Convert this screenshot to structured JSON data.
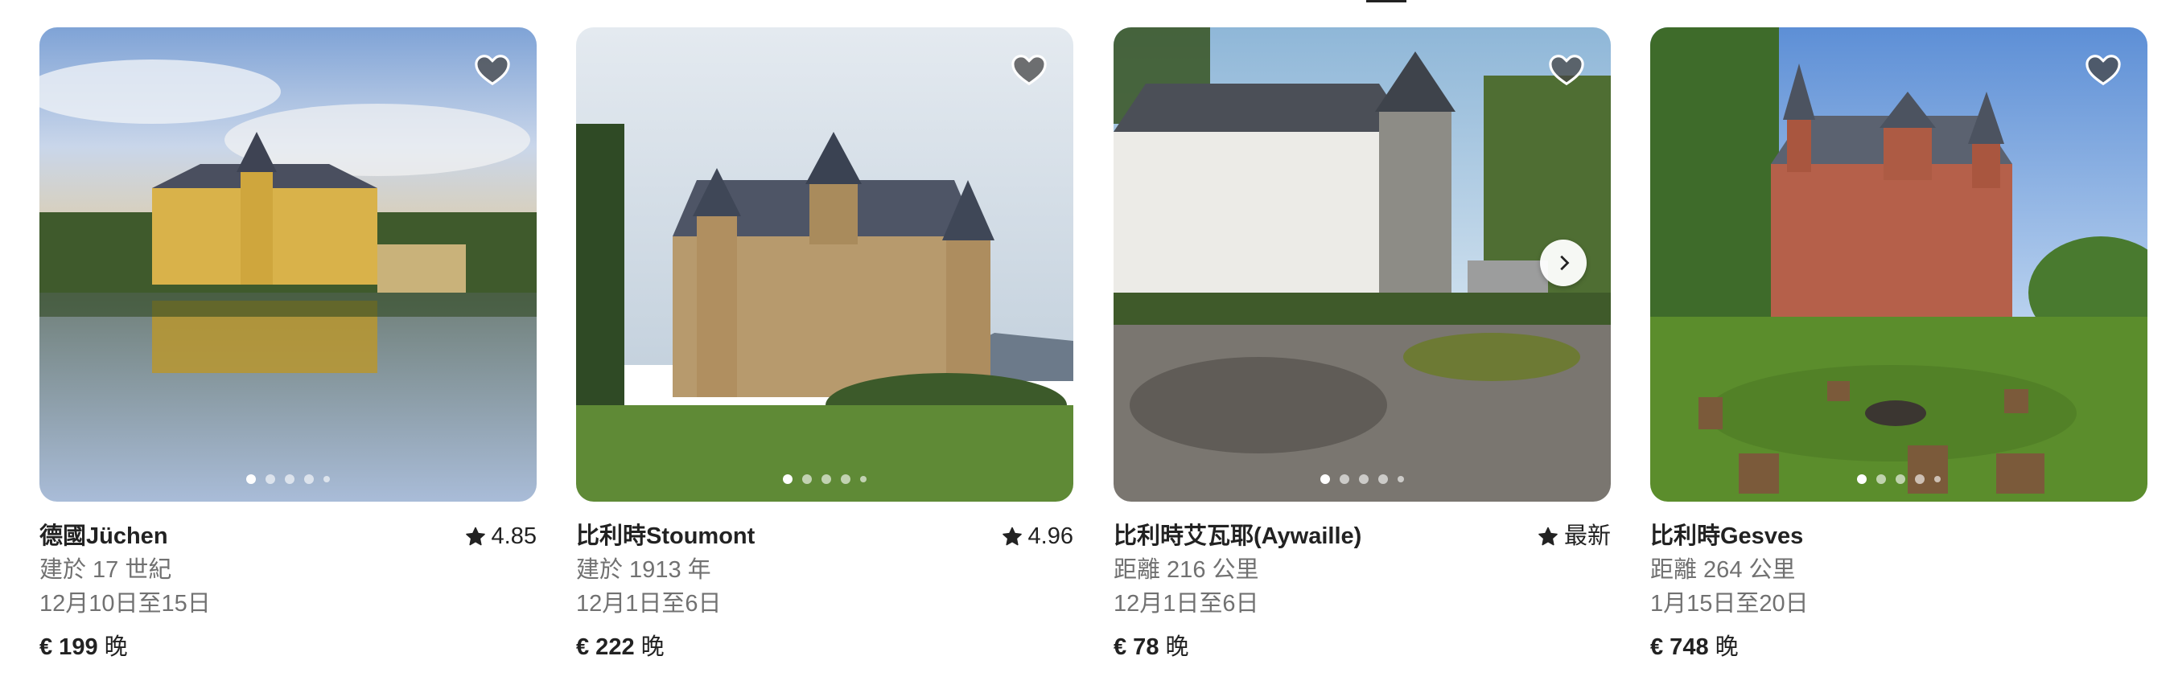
{
  "listings": [
    {
      "location": "德國Jüchen",
      "rating": "4.85",
      "line2": "建於 17 世紀",
      "dates": "12月10日至15日",
      "price": "€ 199",
      "price_unit": "晚",
      "image": "castle-reflected-in-lake",
      "dots_total": 5,
      "dots_active": 0
    },
    {
      "location": "比利時Stoumont",
      "rating": "4.96",
      "line2": "建於 1913 年",
      "dates": "12月1日至6日",
      "price": "€ 222",
      "price_unit": "晚",
      "image": "stone-chateau-with-turrets",
      "dots_total": 5,
      "dots_active": 0
    },
    {
      "location": "比利時艾瓦耶(Aywaille)",
      "rating": "最新",
      "line2": "距離 216 公里",
      "dates": "12月1日至6日",
      "price": "€ 78",
      "price_unit": "晚",
      "image": "white-manor-with-courtyard",
      "dots_total": 5,
      "dots_active": 0
    },
    {
      "location": "比利時Gesves",
      "rating": "",
      "line2": "距離 264 公里",
      "dates": "1月15日至20日",
      "price": "€ 748",
      "price_unit": "晚",
      "image": "brick-castle-with-fire-pit",
      "dots_total": 5,
      "dots_active": 0
    }
  ],
  "icons": {
    "favorite": "heart-icon",
    "rating": "star-icon",
    "next": "chevron-right-icon"
  },
  "colors": {
    "text_primary": "#222222",
    "text_secondary": "#717171",
    "heart_fill": "#5a5a5a"
  }
}
